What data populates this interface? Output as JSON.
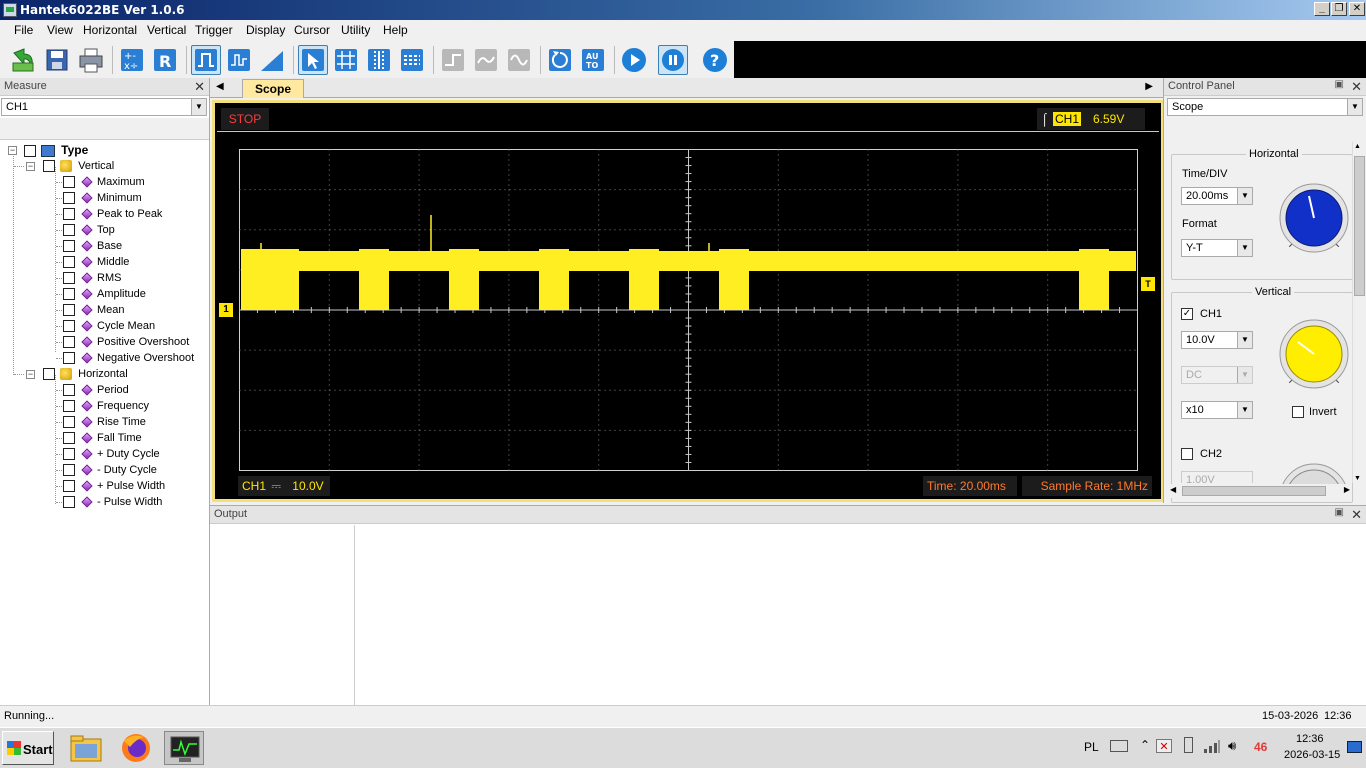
{
  "window": {
    "title": "Hantek6022BE Ver 1.0.6"
  },
  "menu": [
    "File",
    "View",
    "Horizontal",
    "Vertical",
    "Trigger",
    "Display",
    "Cursor",
    "Utility",
    "Help"
  ],
  "toolbar": {
    "icons": [
      "refresh-icon",
      "save-icon",
      "print-icon",
      "math-icon",
      "reference-icon",
      "pulse-wave-icon",
      "step-wave-icon",
      "ramp-wave-icon",
      "pointer-icon",
      "grid-icon",
      "center-grid-icon",
      "dotted-grid-icon",
      "fast-line-icon",
      "slow-line-icon",
      "sine-line-icon",
      "undo-icon",
      "auto-icon",
      "run-icon",
      "pause-icon",
      "help-icon"
    ],
    "auto_label": "AU TO",
    "help_label": "?"
  },
  "measure": {
    "title": "Measure",
    "channel": "CH1",
    "root": "Type",
    "vertical_label": "Vertical",
    "vertical_items": [
      "Maximum",
      "Minimum",
      "Peak to Peak",
      "Top",
      "Base",
      "Middle",
      "RMS",
      "Amplitude",
      "Mean",
      "Cycle Mean",
      "Positive Overshoot",
      "Negative Overshoot"
    ],
    "horizontal_label": "Horizontal",
    "horizontal_items": [
      "Period",
      "Frequency",
      "Rise Time",
      "Fall Time",
      "+ Duty Cycle",
      "- Duty Cycle",
      "+ Pulse Width",
      "- Pulse Width"
    ]
  },
  "scope": {
    "tab": "Scope",
    "status": "STOP",
    "trigger_channel": "CH1",
    "trigger_level": "6.59V",
    "ch_marker": "1",
    "trig_marker": "T",
    "ch_scale_label": "CH1",
    "ch_coupling_sym": "⎓",
    "ch_scale": "10.0V",
    "time": "Time: 20.00ms",
    "sample_rate": "Sample Rate: 1MHz",
    "colors": {
      "trace": "#ffee22",
      "grid": "#808080",
      "stop": "#ff3b3b",
      "info": "#ff7a2a"
    }
  },
  "control": {
    "title": "Control Panel",
    "mode": "Scope",
    "horizontal_title": "Horizontal",
    "time_div_label": "Time/DIV",
    "time_div": "20.00ms",
    "format_label": "Format",
    "format": "Y-T",
    "vertical_title": "Vertical",
    "ch1_label": "CH1",
    "ch1_volt": "10.0V",
    "ch1_coupling": "DC",
    "ch1_probe": "x10",
    "invert_label": "Invert",
    "ch2_label": "CH2",
    "ch2_volt": "1.00V"
  },
  "output": {
    "title": "Output"
  },
  "status": {
    "text": "Running...",
    "date": "15-03-2026",
    "time": "12:36"
  },
  "taskbar": {
    "start": "Start",
    "lang": "PL",
    "tray_count": "46",
    "clock_time": "12:36",
    "clock_date": "2026-03-15"
  }
}
